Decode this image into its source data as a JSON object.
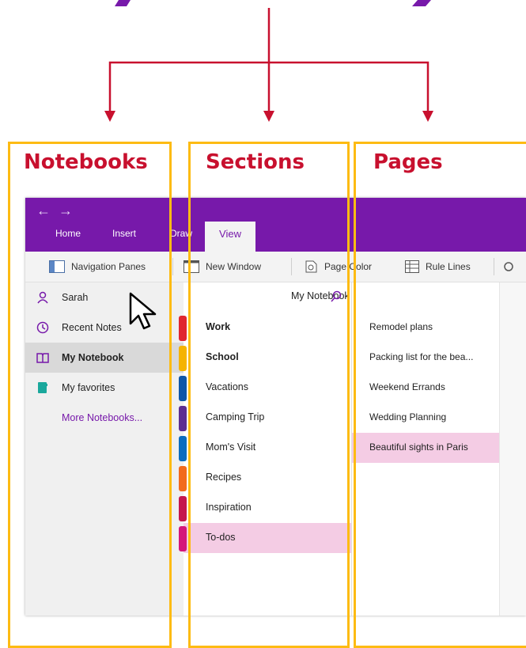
{
  "headings": {
    "notebooks": "Notebooks",
    "sections": "Sections",
    "pages": "Pages"
  },
  "colors": {
    "heading_red": "#c8102e",
    "frame_yellow": "#fdbb13",
    "onenote_purple": "#7719aa",
    "selected_pink": "#f4cce4"
  },
  "app": {
    "nav": {
      "back": "←",
      "forward": "→"
    },
    "ribbon_tabs": [
      "Home",
      "Insert",
      "Draw",
      "View"
    ],
    "active_tab": "View",
    "toolbar": {
      "navigation_panes": "Navigation Panes",
      "new_window": "New Window",
      "page_color": "Page Color",
      "rule_lines": "Rule Lines"
    },
    "notebooks_pane": {
      "user": "Sarah",
      "recent_notes": "Recent Notes",
      "my_notebook": "My Notebook",
      "my_favorites": "My favorites",
      "more_notebooks": "More Notebooks..."
    },
    "sections_pane": {
      "notebook_title": "My Notebook",
      "sections": [
        {
          "label": "Work",
          "color": "#e0262f",
          "bold": true
        },
        {
          "label": "School",
          "color": "#f5b300",
          "bold": true
        },
        {
          "label": "Vacations",
          "color": "#0e56a8",
          "bold": false
        },
        {
          "label": "Camping Trip",
          "color": "#5d2d91",
          "bold": false
        },
        {
          "label": "Mom's Visit",
          "color": "#0b6cbf",
          "bold": false
        },
        {
          "label": "Recipes",
          "color": "#f26b1d",
          "bold": false
        },
        {
          "label": "Inspiration",
          "color": "#c5164d",
          "bold": false
        },
        {
          "label": "To-dos",
          "color": "#d4167a",
          "bold": false
        }
      ],
      "selected": "To-dos"
    },
    "pages_pane": {
      "pages": [
        "Remodel plans",
        "Packing list for the bea...",
        "Weekend Errands",
        "Wedding Planning",
        "Beautiful sights in Paris"
      ],
      "selected": "Beautiful sights in Paris"
    }
  }
}
